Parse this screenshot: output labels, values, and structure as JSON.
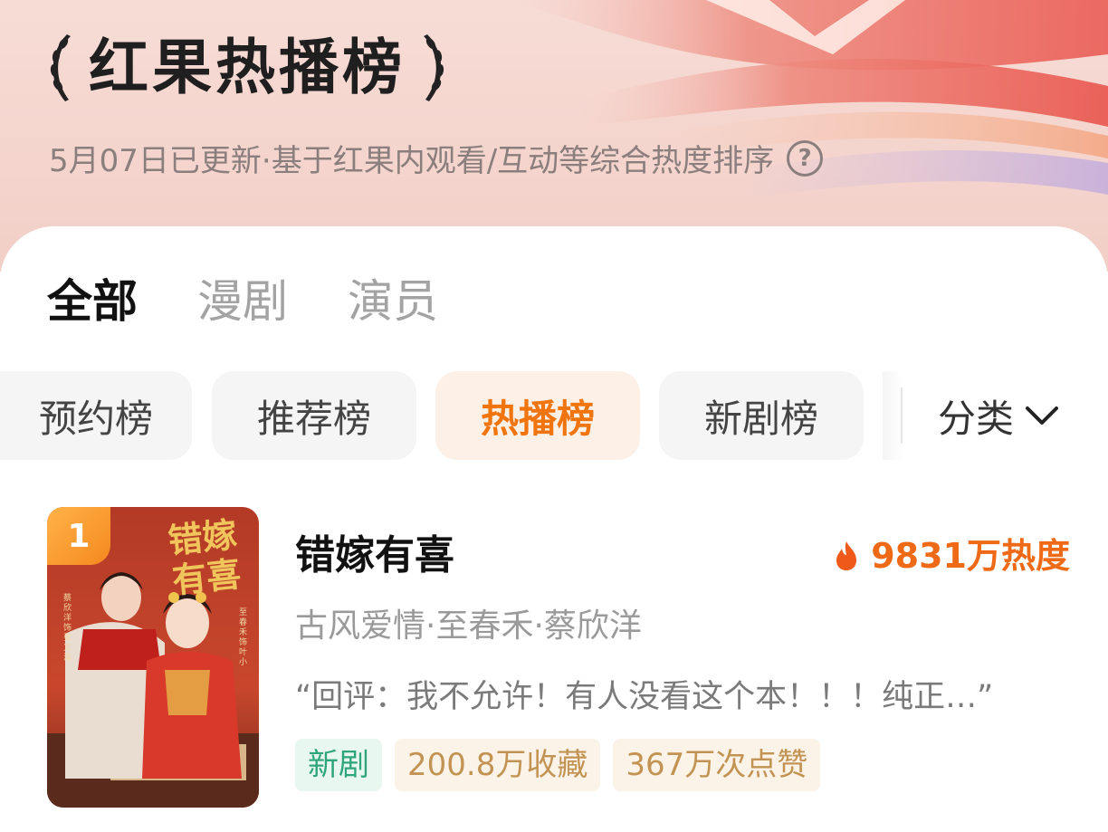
{
  "header": {
    "title": "红果热播榜",
    "subtitle": "5月07日已更新·基于红果内观看/互动等综合热度排序",
    "help_icon": "question-circle-icon"
  },
  "tabs": [
    {
      "label": "全部",
      "active": true
    },
    {
      "label": "漫剧",
      "active": false
    },
    {
      "label": "演员",
      "active": false
    }
  ],
  "chips": [
    {
      "label": "预约榜",
      "active": false
    },
    {
      "label": "推荐榜",
      "active": false
    },
    {
      "label": "热播榜",
      "active": true
    },
    {
      "label": "新剧榜",
      "active": false
    }
  ],
  "filter": {
    "label": "分类",
    "icon": "chevron-down-icon"
  },
  "list": [
    {
      "rank": "1",
      "title": "错嫁有喜",
      "heat": "9831万热度",
      "meta": "古风爱情·至春禾·蔡欣洋",
      "quote": "“回评：我不允许！有人没看这个本！！！纯正…”",
      "tags": [
        "新剧",
        "200.8万收藏",
        "367万次点赞"
      ],
      "poster_title": "错嫁有喜",
      "poster_credits": [
        "蔡欣洋 饰 张叉泽",
        "至春禾 饰 叶小"
      ]
    }
  ],
  "colors": {
    "accent": "#f0750f",
    "heat": "#ef6a17",
    "new_tag": "#2ea57c",
    "stat_tag": "#c29353"
  }
}
